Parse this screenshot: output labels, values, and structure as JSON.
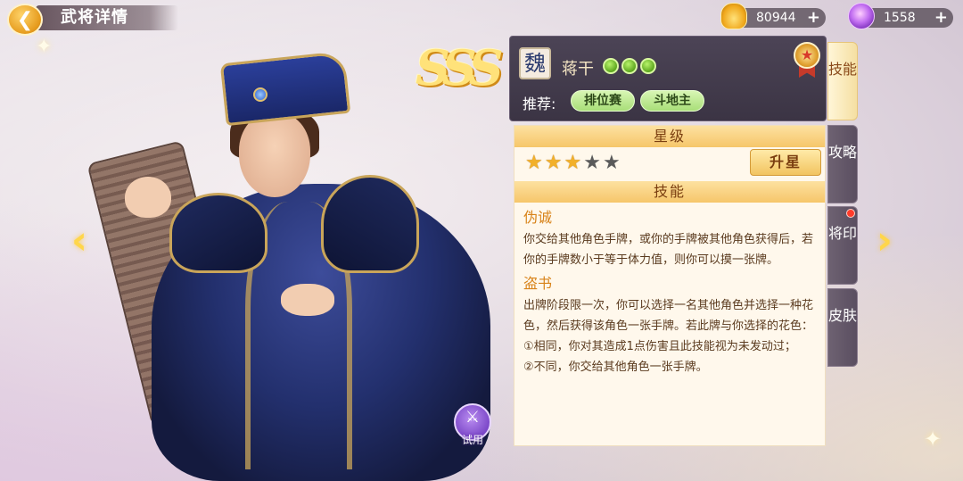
{
  "header": {
    "back_icon": "back-arrow-icon",
    "title": "武将详情"
  },
  "currency": {
    "gold": {
      "icon": "gold-ingot-icon",
      "value": "80944",
      "plus": "+"
    },
    "gem": {
      "icon": "purple-gem-icon",
      "value": "1558",
      "plus": "+"
    }
  },
  "navigation": {
    "prev_icon": "chevron-left-icon",
    "next_icon": "chevron-right-icon"
  },
  "trial": {
    "label": "试用",
    "icon": "crossed-swords-icon"
  },
  "rank": "SSS",
  "hero": {
    "faction": "魏",
    "name": "蒋干",
    "hp": 3,
    "badge_icon": "medal-badge-icon",
    "recommend_label": "推荐:",
    "recommend_tags": [
      "排位赛",
      "斗地主"
    ]
  },
  "tabs": [
    {
      "label": "技能",
      "active": true
    },
    {
      "label": "攻略",
      "active": false
    },
    {
      "label": "将印",
      "active": false,
      "notification": true
    },
    {
      "label": "皮肤",
      "active": false
    }
  ],
  "stars": {
    "header": "星级",
    "filled": 3,
    "total": 5,
    "upgrade_label": "升星"
  },
  "skills_panel": {
    "header": "技能",
    "skills": [
      {
        "name": "伪诚",
        "desc": "你交给其他角色手牌，或你的手牌被其他角色获得后，若你的手牌数小于等于体力值，则你可以摸一张牌。"
      },
      {
        "name": "盗书",
        "desc": "出牌阶段限一次，你可以选择一名其他角色并选择一种花色，然后获得该角色一张手牌。若此牌与你选择的花色：",
        "lines": [
          "①相同，你对其造成1点伤害且此技能视为未发动过；",
          "②不同，你交给其他角色一张手牌。"
        ]
      }
    ]
  },
  "colors": {
    "accent_gold": "#f6c66a",
    "skill_name": "#d8831a",
    "hp_green": "#5ca61e",
    "panel_dark": "#3b3444"
  }
}
